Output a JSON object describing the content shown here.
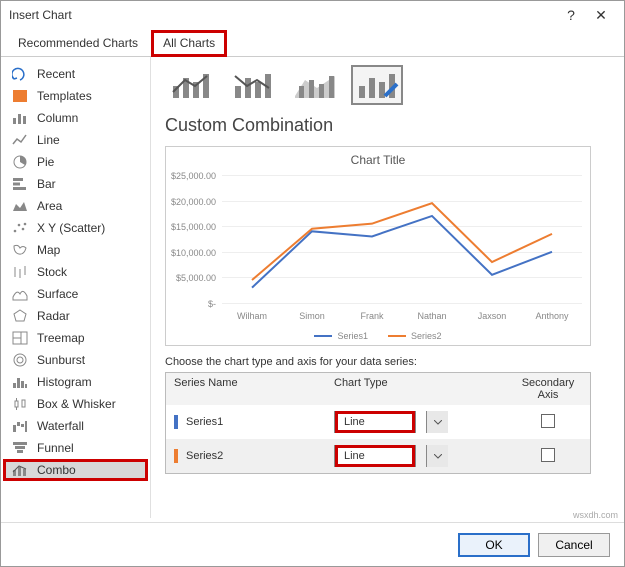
{
  "title": "Insert Chart",
  "tabs": {
    "recommended": "Recommended Charts",
    "all": "All Charts"
  },
  "sidebar": {
    "items": [
      {
        "label": "Recent"
      },
      {
        "label": "Templates"
      },
      {
        "label": "Column"
      },
      {
        "label": "Line"
      },
      {
        "label": "Pie"
      },
      {
        "label": "Bar"
      },
      {
        "label": "Area"
      },
      {
        "label": "X Y (Scatter)"
      },
      {
        "label": "Map"
      },
      {
        "label": "Stock"
      },
      {
        "label": "Surface"
      },
      {
        "label": "Radar"
      },
      {
        "label": "Treemap"
      },
      {
        "label": "Sunburst"
      },
      {
        "label": "Histogram"
      },
      {
        "label": "Box & Whisker"
      },
      {
        "label": "Waterfall"
      },
      {
        "label": "Funnel"
      },
      {
        "label": "Combo"
      }
    ]
  },
  "sectionTitle": "Custom Combination",
  "instruction": "Choose the chart type and axis for your data series:",
  "seriesTable": {
    "headers": {
      "name": "Series Name",
      "type": "Chart Type",
      "sec": "Secondary Axis"
    },
    "rows": [
      {
        "name": "Series1",
        "type": "Line",
        "secondary": false,
        "color": "#4472c4"
      },
      {
        "name": "Series2",
        "type": "Line",
        "secondary": false,
        "color": "#ed7d31"
      }
    ]
  },
  "buttons": {
    "ok": "OK",
    "cancel": "Cancel"
  },
  "watermark": "wsxdh.com",
  "chart_data": {
    "type": "line",
    "title": "Chart Title",
    "xlabel": "",
    "ylabel": "",
    "ylim": [
      0,
      25000
    ],
    "y_ticks": [
      "$-",
      "$5,000.00",
      "$10,000.00",
      "$15,000.00",
      "$20,000.00",
      "$25,000.00"
    ],
    "categories": [
      "Wilham",
      "Simon",
      "Frank",
      "Nathan",
      "Jaxson",
      "Anthony"
    ],
    "legend": [
      "Series1",
      "Series2"
    ],
    "series": [
      {
        "name": "Series1",
        "color": "#4472c4",
        "values": [
          3000,
          14000,
          13000,
          17000,
          5500,
          10000
        ]
      },
      {
        "name": "Series2",
        "color": "#ed7d31",
        "values": [
          4500,
          14500,
          15500,
          19500,
          8000,
          13500
        ]
      }
    ]
  }
}
